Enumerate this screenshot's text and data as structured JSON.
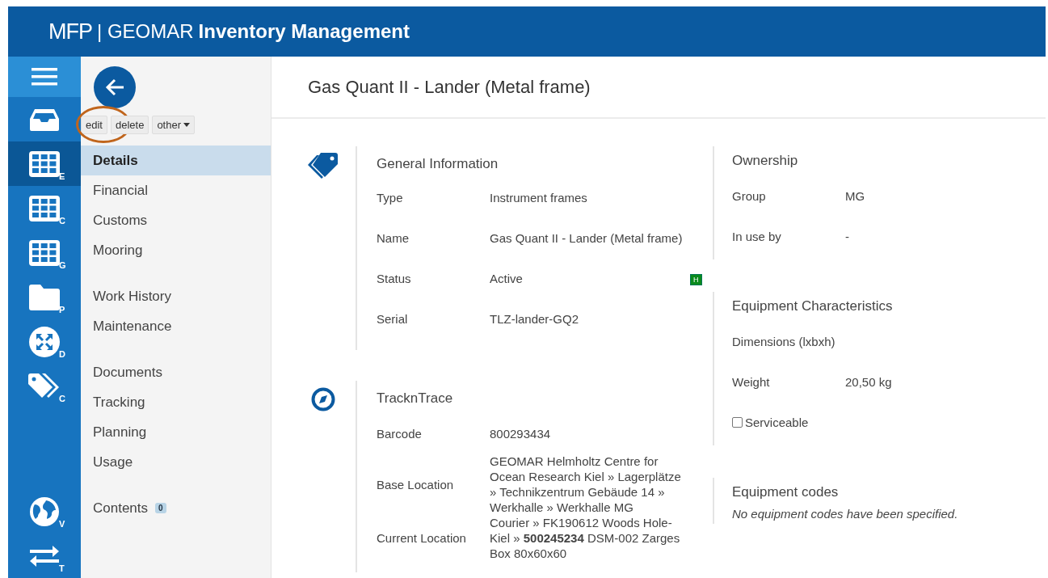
{
  "header": {
    "logo": "MFP",
    "org": "| GEOMAR",
    "app": "Inventory Management"
  },
  "rail": [
    {
      "kind": "menu"
    },
    {
      "kind": "inbox",
      "selected": false
    },
    {
      "kind": "grid",
      "letter": "E",
      "selected": true
    },
    {
      "kind": "grid",
      "letter": "C",
      "selected": false
    },
    {
      "kind": "grid",
      "letter": "G",
      "selected": false
    },
    {
      "kind": "folder",
      "letter": "P",
      "selected": false
    },
    {
      "kind": "expand",
      "letter": "D",
      "selected": false
    },
    {
      "kind": "tags",
      "letter": "C",
      "selected": false
    },
    {
      "kind": "spacer"
    },
    {
      "kind": "globe",
      "letter": "V",
      "selected": false
    },
    {
      "kind": "swap",
      "letter": "T",
      "selected": false
    }
  ],
  "actions": [
    {
      "label": "edit",
      "circled": true
    },
    {
      "label": "delete"
    },
    {
      "label": "other",
      "dropdown": true
    }
  ],
  "nav_groups": [
    [
      {
        "label": "Details",
        "selected": true
      },
      {
        "label": "Financial",
        "selected": false
      },
      {
        "label": "Customs",
        "selected": false
      },
      {
        "label": "Mooring",
        "selected": false
      }
    ],
    [
      {
        "label": "Work History",
        "selected": false
      },
      {
        "label": "Maintenance",
        "selected": false
      }
    ],
    [
      {
        "label": "Documents",
        "selected": false
      },
      {
        "label": "Tracking",
        "selected": false
      },
      {
        "label": "Planning",
        "selected": false
      },
      {
        "label": "Usage",
        "selected": false
      }
    ],
    [
      {
        "label": "Contents",
        "badge": "0",
        "selected": false
      }
    ]
  ],
  "title": "Gas Quant II - Lander (Metal frame)",
  "left_sections": [
    {
      "kind": "tag",
      "title": "General Information",
      "rows": [
        {
          "label": "Type",
          "value": "Instrument frames"
        },
        {
          "label": "Name",
          "value": "Gas Quant II - Lander (Metal frame)"
        },
        {
          "label": "Status",
          "value": "Active",
          "badge": "H"
        },
        {
          "label": "Serial",
          "value": "TLZ-lander-GQ2"
        }
      ]
    },
    {
      "kind": "compass",
      "title": "TracknTrace",
      "rows": [
        {
          "label": "Barcode",
          "value": "800293434"
        },
        {
          "label": "Base Location",
          "value": "GEOMAR Helmholtz Centre for Ocean Research Kiel » Lagerplätze » Technikzentrum Gebäude 14 » Werkhalle » Werkhalle MG"
        },
        {
          "label": "Current Location",
          "value": "Courier » FK190612 Woods Hole-Kiel » **500245234** DSM-002 Zarges Box 80x60x60"
        }
      ]
    }
  ],
  "right_sections": [
    {
      "title": "Ownership",
      "rows": [
        {
          "kind": "pair",
          "label": "Group",
          "value": "MG"
        },
        {
          "kind": "pair",
          "label": "In use by",
          "value": "-"
        }
      ]
    },
    {
      "title": "Equipment Characteristics",
      "rows": [
        {
          "kind": "pair",
          "label": "Dimensions (lxbxh)"
        },
        {
          "kind": "pair",
          "label": "Weight",
          "value": "20,50 kg"
        },
        {
          "kind": "checkbox",
          "label": "Serviceable",
          "checked": false
        }
      ]
    },
    {
      "title": "Equipment codes",
      "note": "No equipment codes have been specified."
    }
  ]
}
